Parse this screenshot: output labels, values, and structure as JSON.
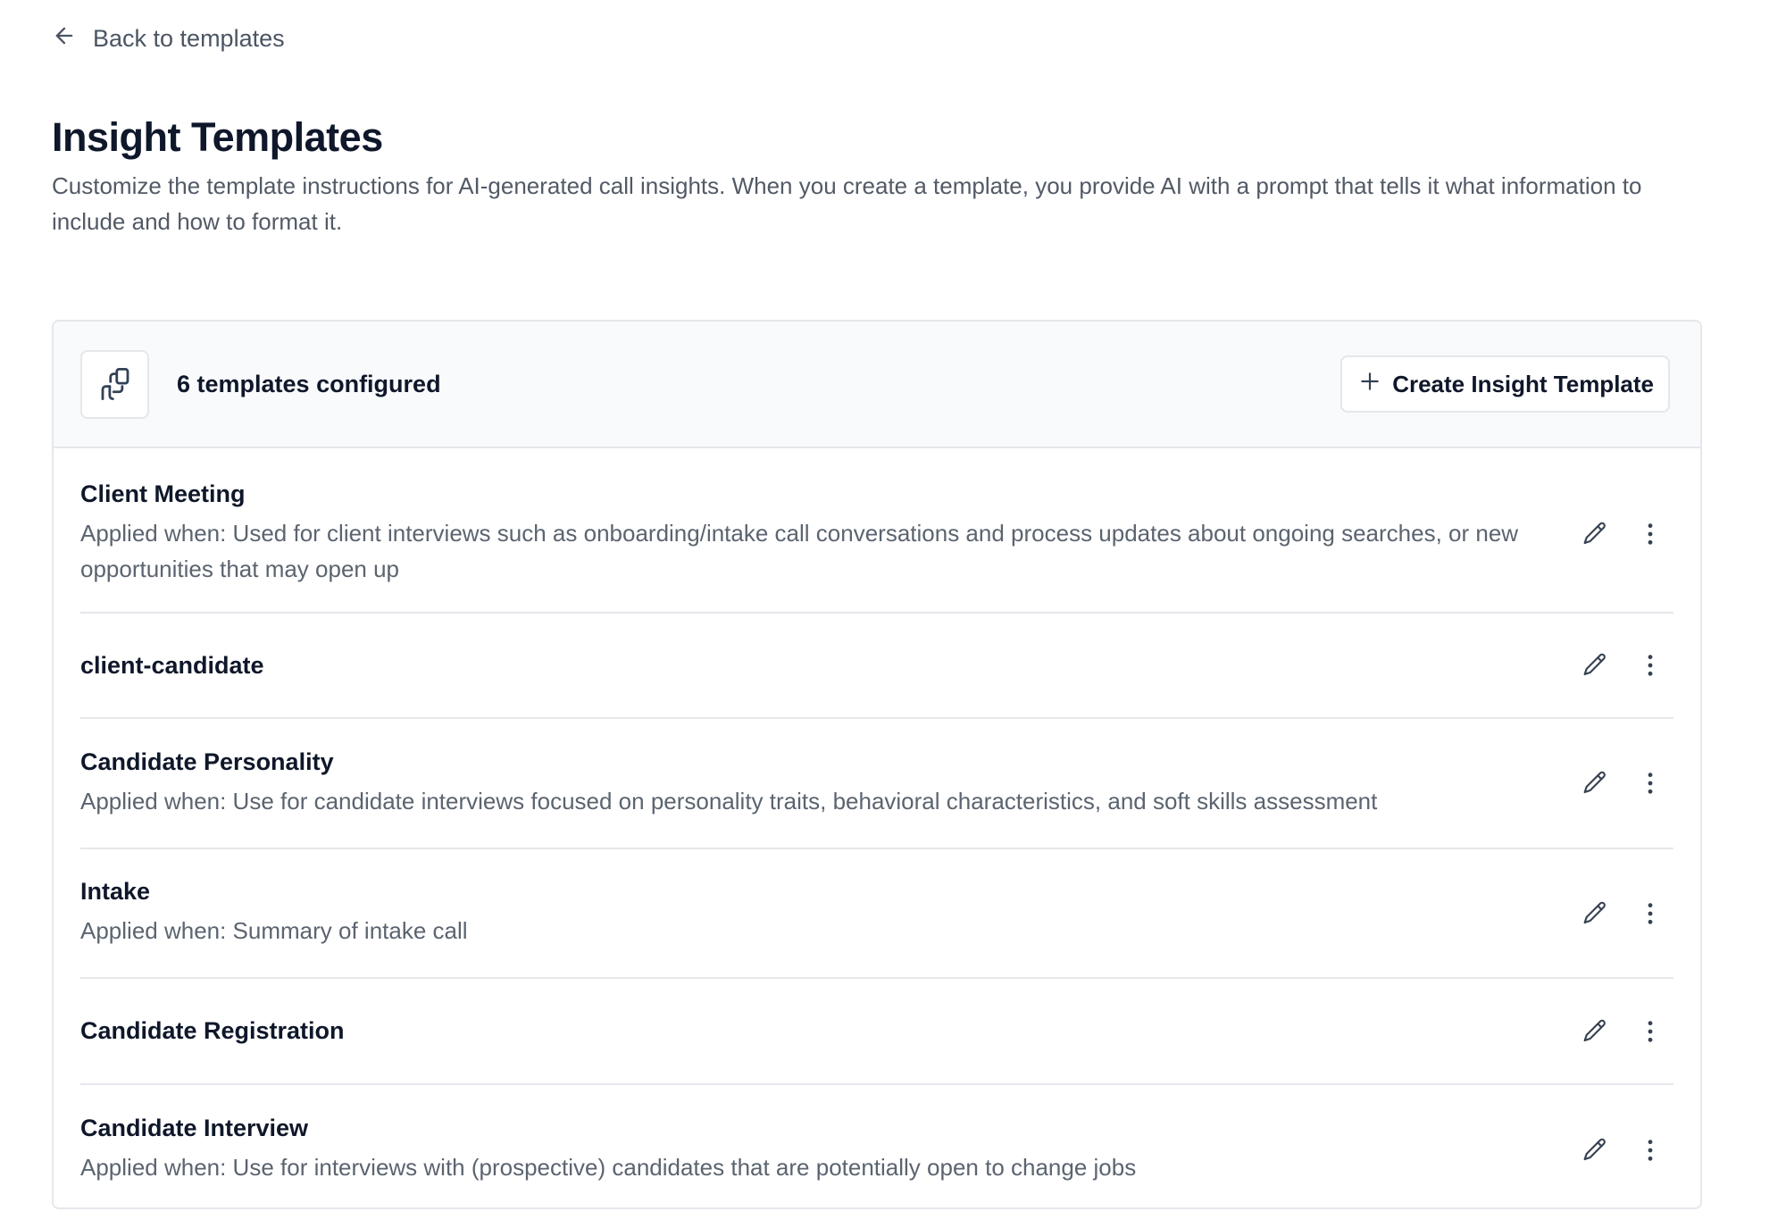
{
  "nav": {
    "back_label": "Back to templates"
  },
  "header": {
    "title": "Insight Templates",
    "description": "Customize the template instructions for AI-generated call insights. When you create a template, you provide AI with a prompt that tells it what information to include and how to format it."
  },
  "card": {
    "count_label": "6 templates configured",
    "create_label": "Create Insight Template",
    "header_icon": "copy-icon"
  },
  "templates": [
    {
      "name": "Client Meeting",
      "applied_when": "Applied when: Used for client interviews such as onboarding/intake call conversations and process updates about ongoing searches, or new opportunities that may open up"
    },
    {
      "name": "client-candidate",
      "applied_when": ""
    },
    {
      "name": "Candidate Personality",
      "applied_when": "Applied when: Use for candidate interviews focused on personality traits, behavioral characteristics, and soft skills assessment"
    },
    {
      "name": "Intake",
      "applied_when": "Applied when: Summary of intake call"
    },
    {
      "name": "Candidate Registration",
      "applied_when": ""
    },
    {
      "name": "Candidate Interview",
      "applied_when": "Applied when: Use for interviews with (prospective) candidates that are potentially open to change jobs"
    }
  ],
  "row_icons": [
    "pencil-icon",
    "more-vertical-icon"
  ],
  "colors": {
    "text_primary": "#0f172a",
    "text_secondary": "#5b6470",
    "border": "#e5e7eb",
    "header_bg": "#f8fafc"
  }
}
